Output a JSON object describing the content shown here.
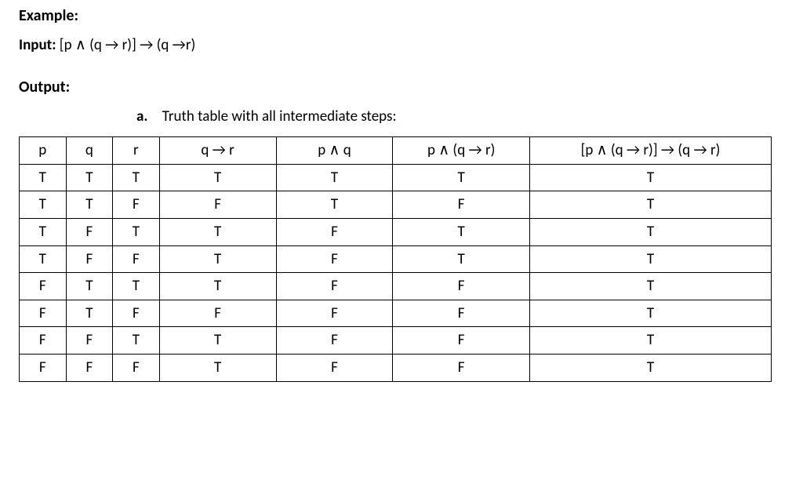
{
  "headings": {
    "example": "Example:",
    "input_label": "Input:",
    "input_expr": "[p ∧ (q → r)] → (q →r)",
    "output_label": "Output:",
    "caption_marker": "a.",
    "caption_text": "Truth table with all intermediate steps:"
  },
  "chart_data": {
    "type": "table",
    "columns": [
      "p",
      "q",
      "r",
      "q → r",
      "p ∧ q",
      "p ∧ (q → r)",
      "[p ∧ (q → r)] → (q → r)"
    ],
    "rows": [
      [
        "T",
        "T",
        "T",
        "T",
        "T",
        "T",
        "T"
      ],
      [
        "T",
        "T",
        "F",
        "F",
        "T",
        "F",
        "T"
      ],
      [
        "T",
        "F",
        "T",
        "T",
        "F",
        "T",
        "T"
      ],
      [
        "T",
        "F",
        "F",
        "T",
        "F",
        "T",
        "T"
      ],
      [
        "F",
        "T",
        "T",
        "T",
        "F",
        "F",
        "T"
      ],
      [
        "F",
        "T",
        "F",
        "F",
        "F",
        "F",
        "T"
      ],
      [
        "F",
        "F",
        "T",
        "T",
        "F",
        "F",
        "T"
      ],
      [
        "F",
        "F",
        "F",
        "T",
        "F",
        "F",
        "T"
      ]
    ]
  }
}
